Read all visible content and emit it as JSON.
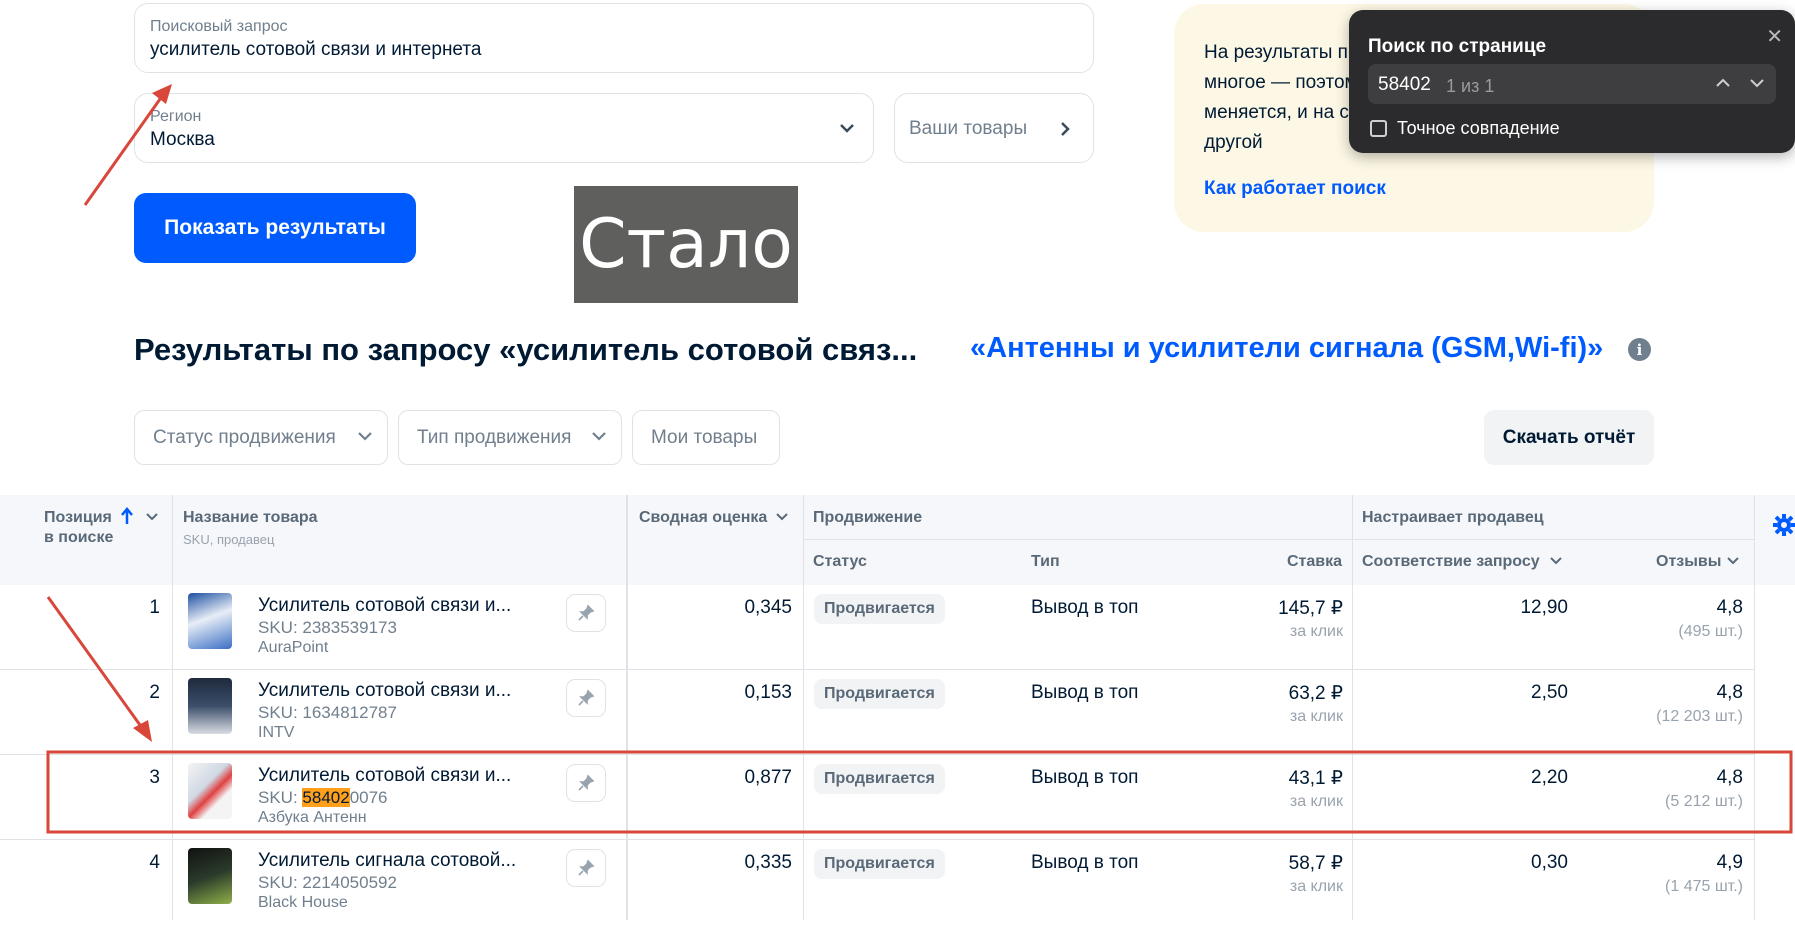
{
  "search": {
    "label": "Поисковый запрос",
    "value": "усилитель сотовой связи и интернета"
  },
  "region": {
    "label": "Регион",
    "value": "Москва"
  },
  "your_goods": "Ваши товары",
  "show_button": "Показать результаты",
  "stalo_label": "Стало",
  "info_box": {
    "lines": [
      "На результаты п",
      "многое — поэтом",
      "меняется, и на с",
      "другой"
    ],
    "link": "Как работает поиск"
  },
  "find_bar": {
    "title": "Поиск по странице",
    "query": "58402",
    "count": "1 из 1",
    "exact_label": "Точное совпадение"
  },
  "results": {
    "title": "Результаты по запросу «усилитель сотовой связ...",
    "category": "«Антенны и усилители сигнала (GSM,Wi-fi)»",
    "info_icon": "i"
  },
  "filters": [
    {
      "label": "Статус продвижения"
    },
    {
      "label": "Тип продвижения"
    },
    {
      "label": "Мои товары"
    }
  ],
  "download_label": "Скачать отчёт",
  "table": {
    "headers": {
      "position": "Позиция",
      "position2": "в поиске",
      "name": "Название товара",
      "name_sub": "SKU, продавец",
      "score": "Сводная оценка",
      "promotion": "Продвижение",
      "status": "Статус",
      "type": "Тип",
      "bid": "Ставка",
      "seller_setup": "Настраивает продавец",
      "relevance": "Соответствие запросу",
      "reviews": "Отзывы"
    },
    "rows": [
      {
        "pos": "1",
        "name": "Усилитель сотовой связи и...",
        "sku": "SKU: 2383539173",
        "seller": "AuraPoint",
        "score": "0,345",
        "status": "Продвигается",
        "type": "Вывод в топ",
        "bid": "145,7 ₽",
        "bid_unit": "за клик",
        "relevance": "12,90",
        "rating": "4,8",
        "reviews": "(495 шт.)"
      },
      {
        "pos": "2",
        "name": "Усилитель сотовой связи и...",
        "sku": "SKU: 1634812787",
        "seller": "INTV",
        "score": "0,153",
        "status": "Продвигается",
        "type": "Вывод в топ",
        "bid": "63,2 ₽",
        "bid_unit": "за клик",
        "relevance": "2,50",
        "rating": "4,8",
        "reviews": "(12 203 шт.)"
      },
      {
        "pos": "3",
        "name": "Усилитель сотовой связи и...",
        "sku_prefix": "SKU: ",
        "sku_hl": "58402",
        "sku_rest": "0076",
        "seller": "Азбука Антенн",
        "score": "0,877",
        "status": "Продвигается",
        "type": "Вывод в топ",
        "bid": "43,1 ₽",
        "bid_unit": "за клик",
        "relevance": "2,20",
        "rating": "4,8",
        "reviews": "(5 212 шт.)"
      },
      {
        "pos": "4",
        "name": "Усилитель сигнала сотовой...",
        "sku": "SKU: 2214050592",
        "seller": "Black House",
        "score": "0,335",
        "status": "Продвигается",
        "type": "Вывод в топ",
        "bid": "58,7 ₽",
        "bid_unit": "за клик",
        "relevance": "0,30",
        "rating": "4,9",
        "reviews": "(1 475 шт.)"
      }
    ]
  },
  "colors": {
    "accent": "#005bff",
    "annotation": "#d9463a",
    "highlight": "#ff9f1a"
  }
}
